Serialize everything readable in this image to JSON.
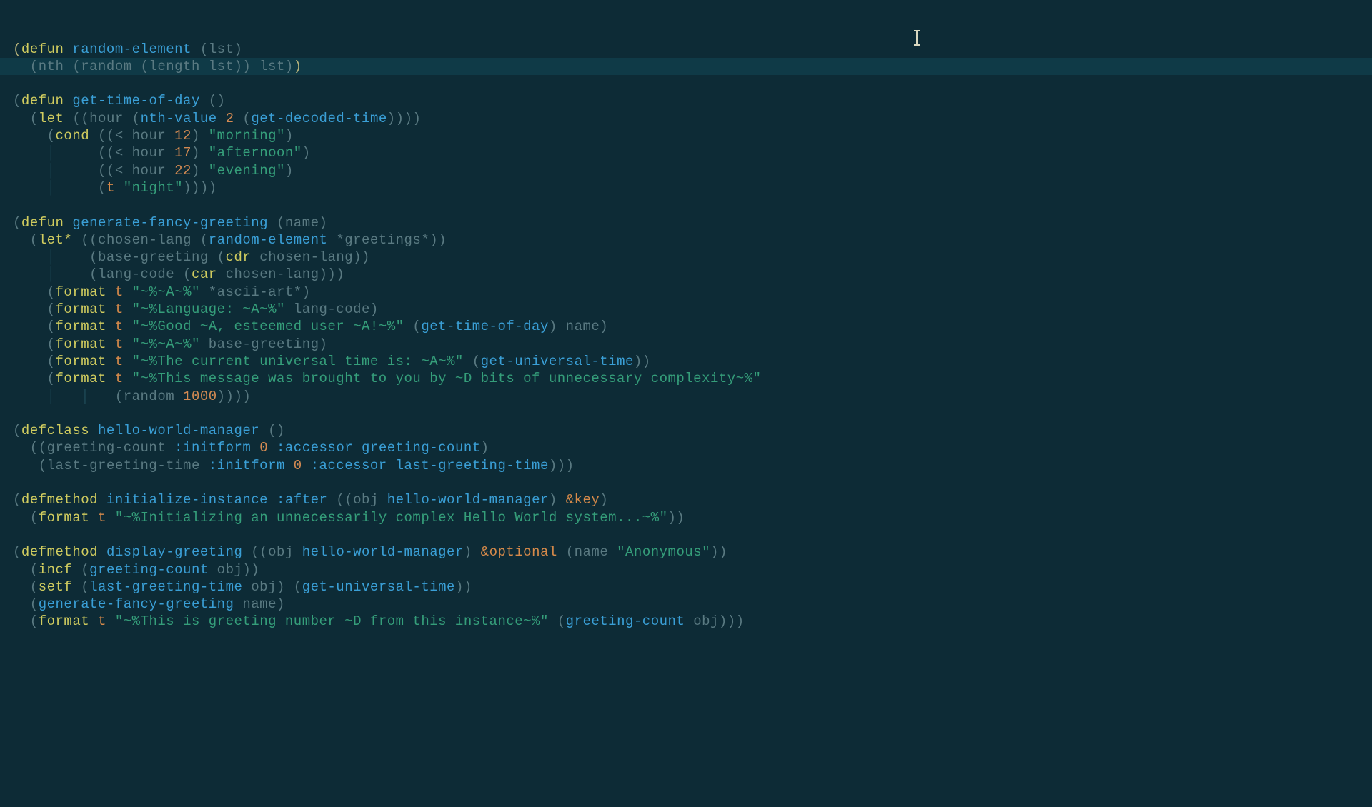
{
  "lines": [
    {
      "segments": [
        {
          "t": "(",
          "c": "paren-b"
        },
        {
          "t": "defun",
          "c": "k"
        },
        {
          "t": " "
        },
        {
          "t": "random-element",
          "c": "fn"
        },
        {
          "t": " ("
        },
        {
          "t": "lst",
          "c": "param"
        },
        {
          "t": ")"
        }
      ]
    },
    {
      "highlight": true,
      "segments": [
        {
          "t": "  (nth (random (length lst)) lst)"
        },
        {
          "t": ")",
          "c": "paren-b"
        }
      ]
    },
    {
      "segments": []
    },
    {
      "segments": [
        {
          "t": "("
        },
        {
          "t": "defun",
          "c": "k"
        },
        {
          "t": " "
        },
        {
          "t": "get-time-of-day",
          "c": "fn"
        },
        {
          "t": " ()"
        }
      ]
    },
    {
      "segments": [
        {
          "t": "  ("
        },
        {
          "t": "let",
          "c": "k"
        },
        {
          "t": " (("
        },
        {
          "t": "hour",
          "c": "ident"
        },
        {
          "t": " ("
        },
        {
          "t": "nth-value",
          "c": "call"
        },
        {
          "t": " "
        },
        {
          "t": "2",
          "c": "num"
        },
        {
          "t": " ("
        },
        {
          "t": "get-decoded-time",
          "c": "call"
        },
        {
          "t": "))))"
        }
      ]
    },
    {
      "segments": [
        {
          "t": "    ("
        },
        {
          "t": "cond",
          "c": "k"
        },
        {
          "t": " ((< hour "
        },
        {
          "t": "12",
          "c": "num"
        },
        {
          "t": ") "
        },
        {
          "t": "\"morning\"",
          "c": "str"
        },
        {
          "t": ")"
        }
      ]
    },
    {
      "segments": [
        {
          "t": "    ",
          "c": "ident"
        },
        {
          "t": "│     ",
          "c": "guide"
        },
        {
          "t": "((< hour "
        },
        {
          "t": "17",
          "c": "num"
        },
        {
          "t": ") "
        },
        {
          "t": "\"afternoon\"",
          "c": "str"
        },
        {
          "t": ")"
        }
      ]
    },
    {
      "segments": [
        {
          "t": "    ",
          "c": "ident"
        },
        {
          "t": "│     ",
          "c": "guide"
        },
        {
          "t": "((< hour "
        },
        {
          "t": "22",
          "c": "num"
        },
        {
          "t": ") "
        },
        {
          "t": "\"evening\"",
          "c": "str"
        },
        {
          "t": ")"
        }
      ]
    },
    {
      "segments": [
        {
          "t": "    ",
          "c": "ident"
        },
        {
          "t": "│     ",
          "c": "guide"
        },
        {
          "t": "("
        },
        {
          "t": "t",
          "c": "lit"
        },
        {
          "t": " "
        },
        {
          "t": "\"night\"",
          "c": "str"
        },
        {
          "t": "))))"
        }
      ]
    },
    {
      "segments": []
    },
    {
      "segments": [
        {
          "t": "("
        },
        {
          "t": "defun",
          "c": "k"
        },
        {
          "t": " "
        },
        {
          "t": "generate-fancy-greeting",
          "c": "fn"
        },
        {
          "t": " ("
        },
        {
          "t": "name",
          "c": "param"
        },
        {
          "t": ")"
        }
      ]
    },
    {
      "segments": [
        {
          "t": "  ("
        },
        {
          "t": "let*",
          "c": "k"
        },
        {
          "t": " (("
        },
        {
          "t": "chosen-lang",
          "c": "ident"
        },
        {
          "t": " ("
        },
        {
          "t": "random-element",
          "c": "call"
        },
        {
          "t": " *greetings*))"
        }
      ]
    },
    {
      "segments": [
        {
          "t": "    ",
          "c": "ident"
        },
        {
          "t": "│    ",
          "c": "guide"
        },
        {
          "t": "("
        },
        {
          "t": "base-greeting",
          "c": "ident"
        },
        {
          "t": " ("
        },
        {
          "t": "cdr",
          "c": "k"
        },
        {
          "t": " chosen-lang))"
        }
      ]
    },
    {
      "segments": [
        {
          "t": "    ",
          "c": "ident"
        },
        {
          "t": "│    ",
          "c": "guide"
        },
        {
          "t": "("
        },
        {
          "t": "lang-code",
          "c": "ident"
        },
        {
          "t": " ("
        },
        {
          "t": "car",
          "c": "k"
        },
        {
          "t": " chosen-lang)))"
        }
      ]
    },
    {
      "segments": [
        {
          "t": "    ("
        },
        {
          "t": "format",
          "c": "k"
        },
        {
          "t": " "
        },
        {
          "t": "t",
          "c": "lit"
        },
        {
          "t": " "
        },
        {
          "t": "\"~%~A~%\"",
          "c": "str"
        },
        {
          "t": " *ascii-art*)"
        }
      ]
    },
    {
      "segments": [
        {
          "t": "    ("
        },
        {
          "t": "format",
          "c": "k"
        },
        {
          "t": " "
        },
        {
          "t": "t",
          "c": "lit"
        },
        {
          "t": " "
        },
        {
          "t": "\"~%Language: ~A~%\"",
          "c": "str"
        },
        {
          "t": " lang-code)"
        }
      ]
    },
    {
      "segments": [
        {
          "t": "    ("
        },
        {
          "t": "format",
          "c": "k"
        },
        {
          "t": " "
        },
        {
          "t": "t",
          "c": "lit"
        },
        {
          "t": " "
        },
        {
          "t": "\"~%Good ~A, esteemed user ~A!~%\"",
          "c": "str"
        },
        {
          "t": " ("
        },
        {
          "t": "get-time-of-day",
          "c": "call"
        },
        {
          "t": ") name)"
        }
      ]
    },
    {
      "segments": [
        {
          "t": "    ("
        },
        {
          "t": "format",
          "c": "k"
        },
        {
          "t": " "
        },
        {
          "t": "t",
          "c": "lit"
        },
        {
          "t": " "
        },
        {
          "t": "\"~%~A~%\"",
          "c": "str"
        },
        {
          "t": " base-greeting)"
        }
      ]
    },
    {
      "segments": [
        {
          "t": "    ("
        },
        {
          "t": "format",
          "c": "k"
        },
        {
          "t": " "
        },
        {
          "t": "t",
          "c": "lit"
        },
        {
          "t": " "
        },
        {
          "t": "\"~%The current universal time is: ~A~%\"",
          "c": "str"
        },
        {
          "t": " ("
        },
        {
          "t": "get-universal-time",
          "c": "call"
        },
        {
          "t": "))"
        }
      ]
    },
    {
      "segments": [
        {
          "t": "    ("
        },
        {
          "t": "format",
          "c": "k"
        },
        {
          "t": " "
        },
        {
          "t": "t",
          "c": "lit"
        },
        {
          "t": " "
        },
        {
          "t": "\"~%This message was brought to you by ~D bits of unnecessary complexity~%\"",
          "c": "str"
        }
      ]
    },
    {
      "segments": [
        {
          "t": "    ",
          "c": "ident"
        },
        {
          "t": "│   │   ",
          "c": "guide"
        },
        {
          "t": "(random "
        },
        {
          "t": "1000",
          "c": "num"
        },
        {
          "t": "))))"
        }
      ]
    },
    {
      "segments": []
    },
    {
      "segments": [
        {
          "t": "("
        },
        {
          "t": "defclass",
          "c": "k"
        },
        {
          "t": " "
        },
        {
          "t": "hello-world-manager",
          "c": "fn"
        },
        {
          "t": " ()"
        }
      ]
    },
    {
      "segments": [
        {
          "t": "  (("
        },
        {
          "t": "greeting-count",
          "c": "ident"
        },
        {
          "t": " "
        },
        {
          "t": ":initform",
          "c": "sym"
        },
        {
          "t": " "
        },
        {
          "t": "0",
          "c": "num"
        },
        {
          "t": " "
        },
        {
          "t": ":accessor",
          "c": "sym"
        },
        {
          "t": " "
        },
        {
          "t": "greeting-count",
          "c": "call"
        },
        {
          "t": ")"
        }
      ]
    },
    {
      "segments": [
        {
          "t": "   ("
        },
        {
          "t": "last-greeting-time",
          "c": "ident"
        },
        {
          "t": " "
        },
        {
          "t": ":initform",
          "c": "sym"
        },
        {
          "t": " "
        },
        {
          "t": "0",
          "c": "num"
        },
        {
          "t": " "
        },
        {
          "t": ":accessor",
          "c": "sym"
        },
        {
          "t": " "
        },
        {
          "t": "last-greeting-time",
          "c": "call"
        },
        {
          "t": ")))"
        }
      ]
    },
    {
      "segments": []
    },
    {
      "segments": [
        {
          "t": "("
        },
        {
          "t": "defmethod",
          "c": "k"
        },
        {
          "t": " "
        },
        {
          "t": "initialize-instance",
          "c": "fn"
        },
        {
          "t": " "
        },
        {
          "t": ":after",
          "c": "sym"
        },
        {
          "t": " (("
        },
        {
          "t": "obj",
          "c": "ident"
        },
        {
          "t": " "
        },
        {
          "t": "hello-world-manager",
          "c": "call"
        },
        {
          "t": ") "
        },
        {
          "t": "&key",
          "c": "amp"
        },
        {
          "t": ")"
        }
      ]
    },
    {
      "segments": [
        {
          "t": "  ("
        },
        {
          "t": "format",
          "c": "k"
        },
        {
          "t": " "
        },
        {
          "t": "t",
          "c": "lit"
        },
        {
          "t": " "
        },
        {
          "t": "\"~%Initializing an unnecessarily complex Hello World system...~%\"",
          "c": "str"
        },
        {
          "t": "))"
        }
      ]
    },
    {
      "segments": []
    },
    {
      "segments": [
        {
          "t": "("
        },
        {
          "t": "defmethod",
          "c": "k"
        },
        {
          "t": " "
        },
        {
          "t": "display-greeting",
          "c": "fn"
        },
        {
          "t": " (("
        },
        {
          "t": "obj",
          "c": "ident"
        },
        {
          "t": " "
        },
        {
          "t": "hello-world-manager",
          "c": "call"
        },
        {
          "t": ") "
        },
        {
          "t": "&optional",
          "c": "amp"
        },
        {
          "t": " ("
        },
        {
          "t": "name",
          "c": "ident"
        },
        {
          "t": " "
        },
        {
          "t": "\"Anonymous\"",
          "c": "str"
        },
        {
          "t": "))"
        }
      ]
    },
    {
      "segments": [
        {
          "t": "  ("
        },
        {
          "t": "incf",
          "c": "k"
        },
        {
          "t": " ("
        },
        {
          "t": "greeting-count",
          "c": "call"
        },
        {
          "t": " obj))"
        }
      ]
    },
    {
      "segments": [
        {
          "t": "  ("
        },
        {
          "t": "setf",
          "c": "k"
        },
        {
          "t": " ("
        },
        {
          "t": "last-greeting-time",
          "c": "call"
        },
        {
          "t": " obj) ("
        },
        {
          "t": "get-universal-time",
          "c": "call"
        },
        {
          "t": "))"
        }
      ]
    },
    {
      "segments": [
        {
          "t": "  ("
        },
        {
          "t": "generate-fancy-greeting",
          "c": "call"
        },
        {
          "t": " name)"
        }
      ]
    },
    {
      "segments": [
        {
          "t": "  ("
        },
        {
          "t": "format",
          "c": "k"
        },
        {
          "t": " "
        },
        {
          "t": "t",
          "c": "lit"
        },
        {
          "t": " "
        },
        {
          "t": "\"~%This is greeting number ~D from this instance~%\"",
          "c": "str"
        },
        {
          "t": " ("
        },
        {
          "t": "greeting-count",
          "c": "call"
        },
        {
          "t": " obj)))"
        }
      ]
    }
  ]
}
